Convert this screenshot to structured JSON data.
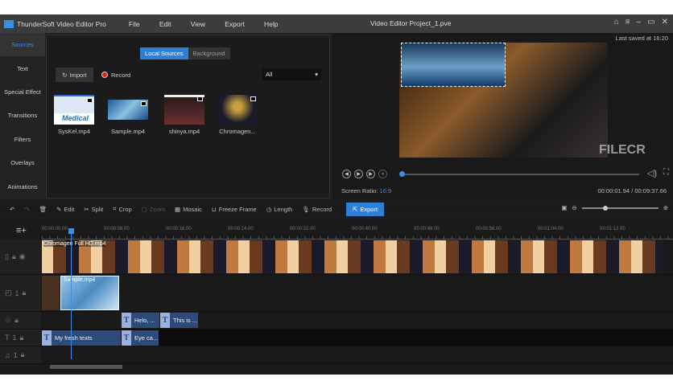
{
  "app": {
    "name": "ThunderSoft Video Editor Pro",
    "project_title": "Video Editor Project_1.pve",
    "menu": [
      "File",
      "Edit",
      "View",
      "Export",
      "Help"
    ],
    "window_icons": [
      "home-icon",
      "menu-icon",
      "minimize-icon",
      "restore-icon",
      "close-icon"
    ]
  },
  "sidebar": {
    "items": [
      "Sources",
      "Text",
      "Special Effect",
      "Transitions",
      "Filters",
      "Overlays",
      "Animations"
    ],
    "active": "Sources"
  },
  "sources": {
    "tabs": [
      "Local Sources",
      "Background"
    ],
    "active_tab": "Local Sources",
    "import_label": "Import",
    "record_label": "Record",
    "filter_value": "All",
    "files": [
      "SysKel.mp4",
      "Sample.mp4",
      "shinya.mp4",
      "Chromagen..."
    ]
  },
  "preview": {
    "last_saved": "Last saved at 16:20",
    "ratio_label": "Screen Ratio:",
    "ratio_value": "16:9",
    "current_time": "00:00:01.94",
    "total_time": "00:09:37.66",
    "time_sep": " / ",
    "watermark": "FILECR",
    "progress": 0.003
  },
  "toolbar": {
    "edit": "Edit",
    "split": "Split",
    "crop": "Crop",
    "zoom": "Zoom",
    "mosaic": "Mosaic",
    "freeze": "Freeze Frame",
    "length": "Length",
    "record": "Record",
    "export": "Export"
  },
  "timeline": {
    "ruler": [
      "00:00:00.00",
      "00:00:08.00",
      "00:00:16.00",
      "00:00:24.00",
      "00:00:32.00",
      "00:00:40.00",
      "00:00:48.00",
      "00:00:56.00",
      "00:01:04.00",
      "00:01:12.00"
    ],
    "video_clip": "Chromagen Full HD.mp4",
    "overlay_clip": "Sample.mp4",
    "effect_texts": [
      "Helo, ...",
      "This is ..."
    ],
    "text_clips": [
      "My fresh texts",
      "Eye ca..."
    ],
    "track_numbers": [
      "1",
      "1",
      "1"
    ]
  },
  "colors": {
    "accent": "#2f7fd9",
    "background": "#1e1e1e"
  }
}
